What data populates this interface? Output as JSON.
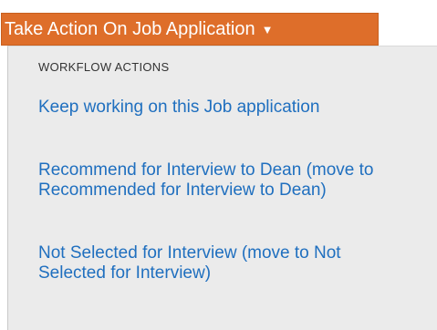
{
  "action_button": {
    "label": "Take Action On Job Application",
    "icon": "caret-down-icon",
    "color": "#de6e2a"
  },
  "menu": {
    "header": "WORKFLOW ACTIONS",
    "items": [
      {
        "label": "Keep working on this Job application"
      },
      {
        "label": "Recommend for Interview to Dean (move to Recommended for Interview to Dean)"
      },
      {
        "label": "Not Selected for Interview (move to Not Selected for Interview)"
      }
    ],
    "link_color": "#1f6fbf",
    "background": "#ebebeb"
  }
}
